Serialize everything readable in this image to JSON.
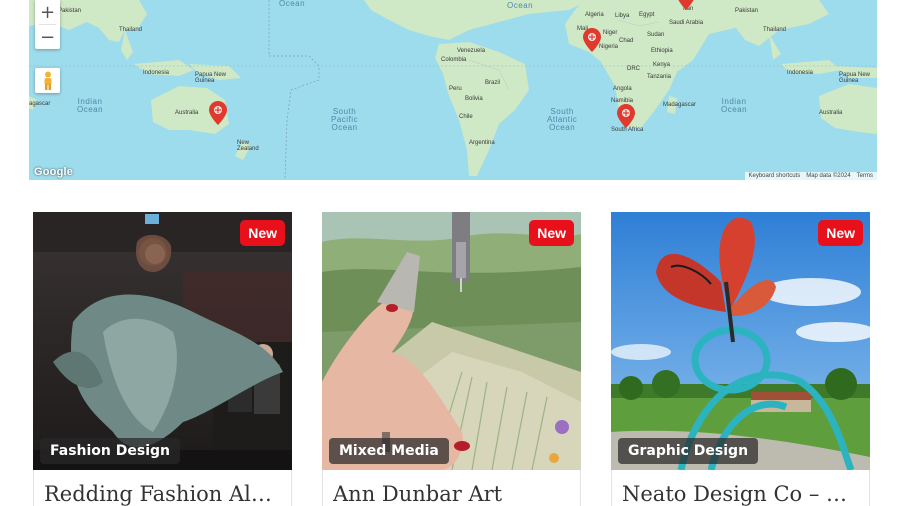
{
  "map": {
    "controls": {
      "zoom_in": "+",
      "zoom_out": "−"
    },
    "logo": "Google",
    "attribution": [
      "Keyboard shortcuts",
      "Map data ©2024",
      "Terms"
    ],
    "oceans": {
      "indian_left": "Indian\nOcean",
      "south_pacific": "South\nPacific\nOcean",
      "south_atlantic": "South\nAtlantic\nOcean",
      "indian_right": "Indian\nOcean",
      "top_ocean_1": "Ocean",
      "top_ocean_2": "Ocean"
    },
    "countries": {
      "pakistan_l": "Pakistan",
      "thailand": "Thailand",
      "indonesia_l": "Indonesia",
      "papua_l": "Papua New\nGuinea",
      "australia_l": "Australia",
      "new_zealand": "New\nZealand",
      "madagascar_l": "agascar",
      "venezuela": "Venezuela",
      "colombia": "Colombia",
      "peru": "Peru",
      "brazil": "Brazil",
      "bolivia": "Bolivia",
      "chile": "Chile",
      "argentina": "Argentina",
      "algeria": "Algeria",
      "libya": "Libya",
      "egypt": "Egypt",
      "saudi": "Saudi Arabia",
      "mali": "Mali",
      "niger": "Niger",
      "chad": "Chad",
      "sudan": "Sudan",
      "nigeria": "Nigeria",
      "ethiopia": "Ethiopia",
      "drc": "DRC",
      "kenya": "Kenya",
      "tanzania": "Tanzania",
      "angola": "Angola",
      "namibia": "Namibia",
      "madagascar_r": "Madagascar",
      "south_africa": "South Africa",
      "iran": "Iran",
      "pakistan_r": "Pakistan",
      "thailand_r": "Thailand",
      "indonesia_r": "Indonesia",
      "papua_r": "Papua New\nGuinea",
      "australia_r": "Australia"
    }
  },
  "cards": [
    {
      "badge": "New",
      "category": "Fashion Design",
      "title": "Redding Fashion Al…"
    },
    {
      "badge": "New",
      "category": "Mixed Media",
      "title": "Ann Dunbar Art"
    },
    {
      "badge": "New",
      "category": "Graphic Design",
      "title": "Neato Design Co – K…"
    }
  ],
  "colors": {
    "badge_new": "#e8101b",
    "map_water": "#9ddcec",
    "map_land": "#cfe8c5",
    "marker": "#e03a2f"
  }
}
